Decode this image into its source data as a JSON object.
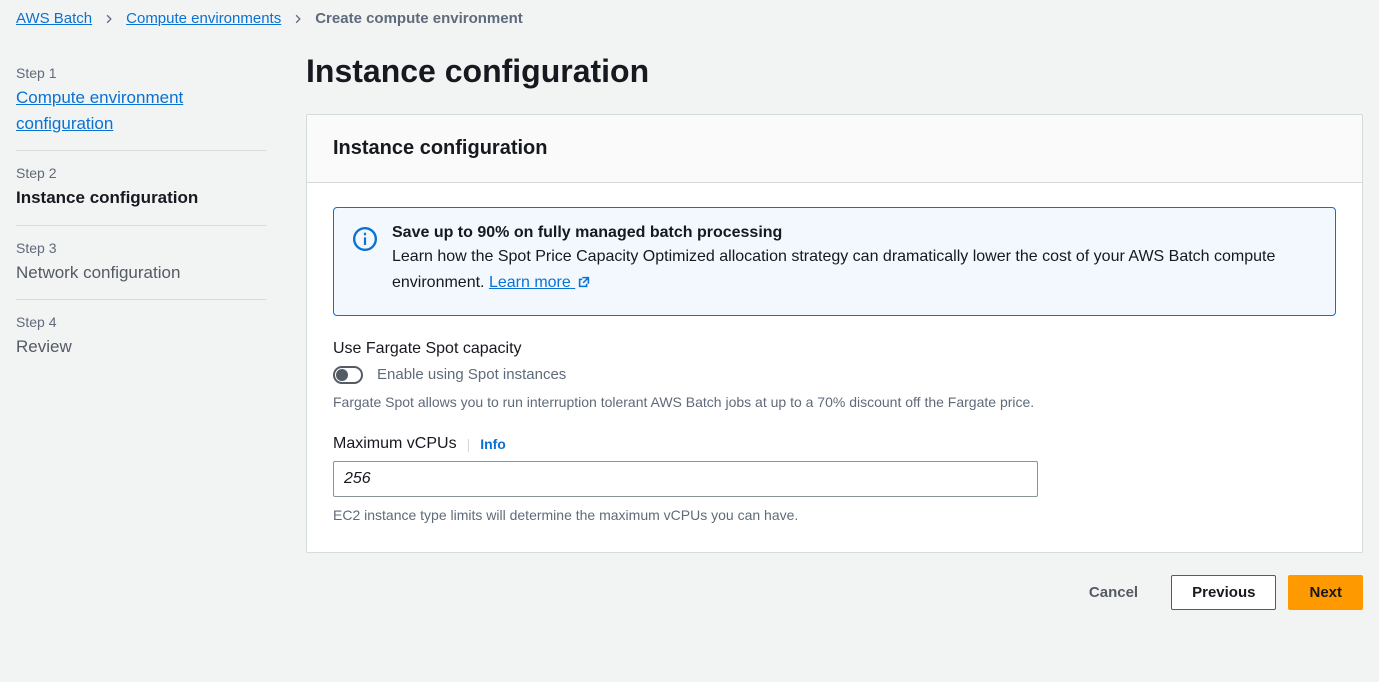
{
  "breadcrumb": {
    "items": [
      {
        "label": "AWS Batch",
        "link": true
      },
      {
        "label": "Compute environments",
        "link": true
      },
      {
        "label": "Create compute environment",
        "link": false
      }
    ]
  },
  "wizard": {
    "steps": [
      {
        "num": "Step 1",
        "title": "Compute environment configuration",
        "state": "link"
      },
      {
        "num": "Step 2",
        "title": "Instance configuration",
        "state": "active"
      },
      {
        "num": "Step 3",
        "title": "Network configuration",
        "state": "upcoming"
      },
      {
        "num": "Step 4",
        "title": "Review",
        "state": "upcoming"
      }
    ]
  },
  "page": {
    "title": "Instance configuration",
    "panel_title": "Instance configuration"
  },
  "alert": {
    "title": "Save up to 90% on fully managed batch processing",
    "body": "Learn how the Spot Price Capacity Optimized allocation strategy can dramatically lower the cost of your AWS Batch compute environment.",
    "learn_more": "Learn more"
  },
  "fargate": {
    "label": "Use Fargate Spot capacity",
    "toggle_label": "Enable using Spot instances",
    "enabled": false,
    "helper": "Fargate Spot allows you to run interruption tolerant AWS Batch jobs at up to a 70% discount off the Fargate price."
  },
  "vcpus": {
    "label": "Maximum vCPUs",
    "info_label": "Info",
    "value": "256",
    "helper": "EC2 instance type limits will determine the maximum vCPUs you can have."
  },
  "actions": {
    "cancel": "Cancel",
    "previous": "Previous",
    "next": "Next"
  }
}
